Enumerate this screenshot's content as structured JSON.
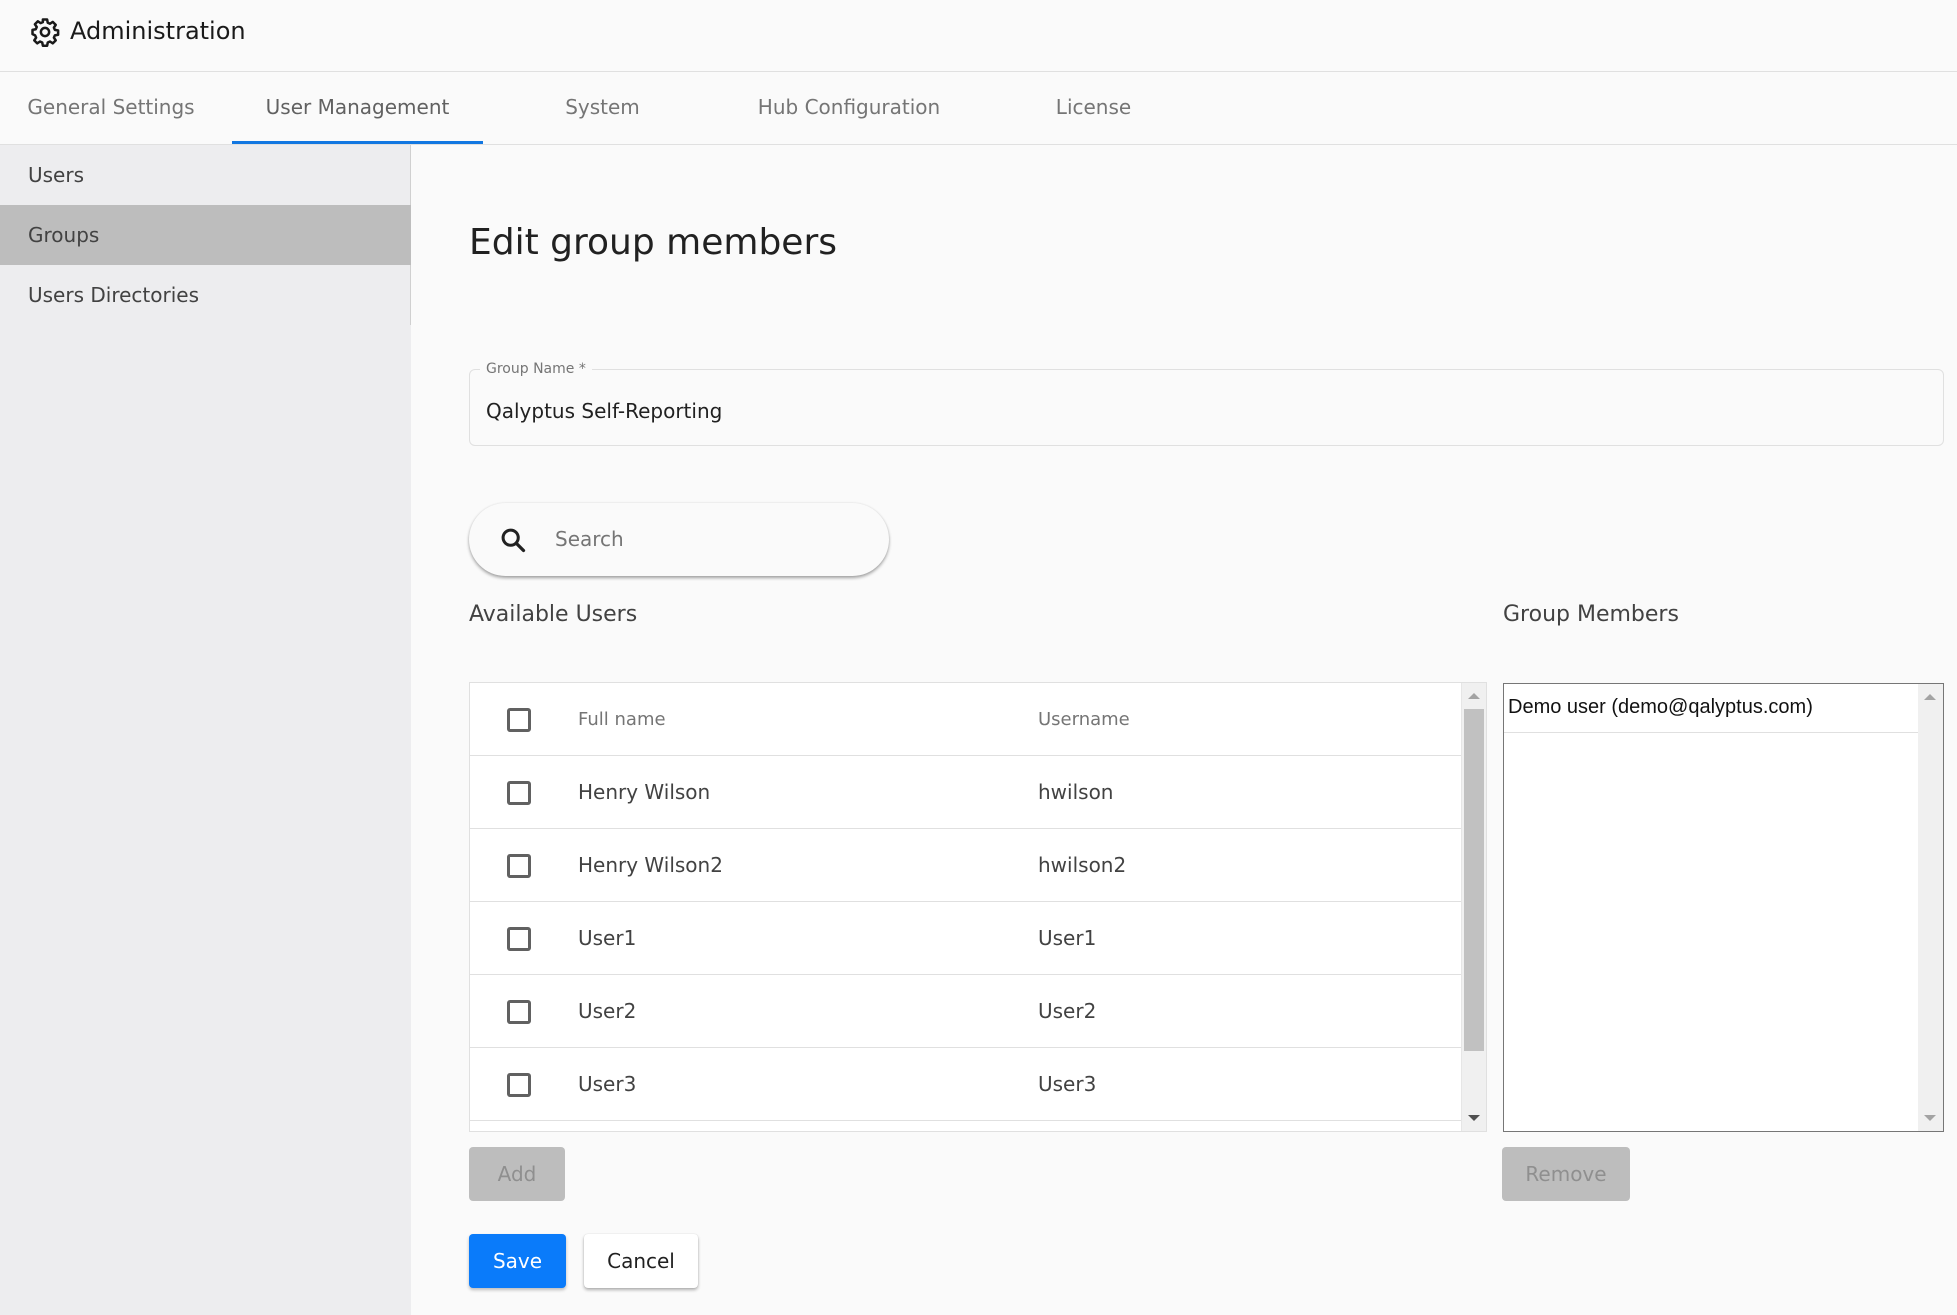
{
  "header": {
    "title": "Administration",
    "icon": "gear-icon"
  },
  "tabs": [
    {
      "label": "General Settings",
      "active": false
    },
    {
      "label": "User Management",
      "active": true
    },
    {
      "label": "System",
      "active": false
    },
    {
      "label": "Hub Configuration",
      "active": false
    },
    {
      "label": "License",
      "active": false
    }
  ],
  "sidebar": {
    "items": [
      {
        "label": "Users",
        "selected": false
      },
      {
        "label": "Groups",
        "selected": true
      },
      {
        "label": "Users Directories",
        "selected": false
      }
    ]
  },
  "main": {
    "title": "Edit group members",
    "group_name": {
      "label": "Group Name *",
      "value": "Qalyptus Self-Reporting"
    },
    "search": {
      "placeholder": "Search",
      "value": ""
    },
    "available_users": {
      "label": "Available Users",
      "columns": [
        "Full name",
        "Username"
      ],
      "rows": [
        {
          "full_name": "Henry Wilson",
          "username": "hwilson",
          "checked": false
        },
        {
          "full_name": "Henry Wilson2",
          "username": "hwilson2",
          "checked": false
        },
        {
          "full_name": "User1",
          "username": "User1",
          "checked": false
        },
        {
          "full_name": "User2",
          "username": "User2",
          "checked": false
        },
        {
          "full_name": "User3",
          "username": "User3",
          "checked": false
        }
      ],
      "add_label": "Add"
    },
    "group_members": {
      "label": "Group Members",
      "items": [
        "Demo user (demo@qalyptus.com)"
      ],
      "remove_label": "Remove"
    },
    "save_label": "Save",
    "cancel_label": "Cancel"
  },
  "colors": {
    "accent": "#1277e1",
    "primary_button": "#0a7bfa",
    "disabled_button": "#bdbdbd",
    "sidebar_selected": "#bdbdbd"
  }
}
